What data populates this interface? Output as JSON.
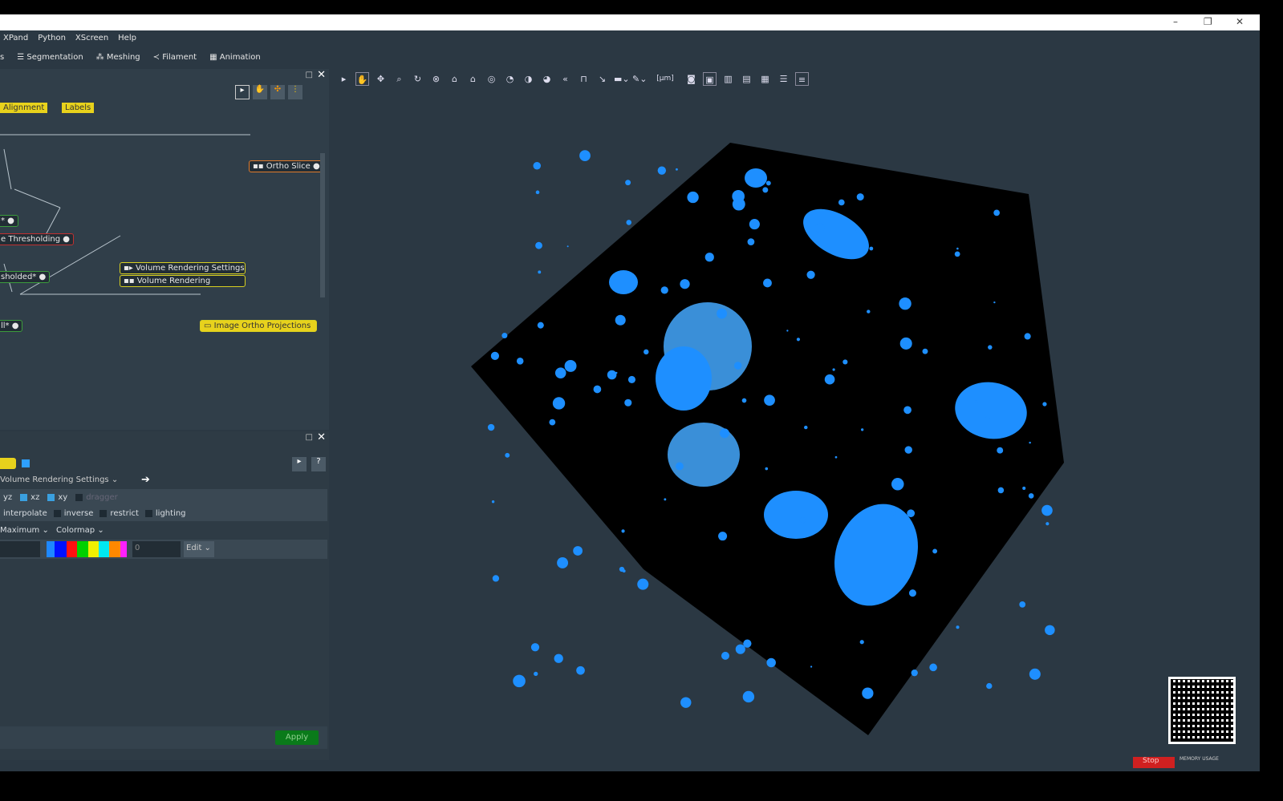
{
  "menu": [
    "XPand",
    "Python",
    "XScreen",
    "Help"
  ],
  "workspaces": [
    "s",
    "Segmentation",
    "Meshing",
    "Filament",
    "Animation"
  ],
  "tags": [
    "Alignment",
    "Labels"
  ],
  "nodes": {
    "ortho_slice": "Ortho Slice",
    "thresholding": "e Thresholding",
    "thresholded": "sholded*",
    "vr_settings": "Volume Rendering Settings",
    "vr": "Volume Rendering",
    "projections": "Image Ortho Projections",
    "n1": "*",
    "n2": "ll*"
  },
  "props": {
    "data_select": "Volume Rendering Settings",
    "checks": [
      {
        "label": "yz",
        "on": true
      },
      {
        "label": "xz",
        "on": true
      },
      {
        "label": "xy",
        "on": true
      },
      {
        "label": "dragger",
        "on": false
      }
    ],
    "options": [
      {
        "label": "interpolate",
        "on": false
      },
      {
        "label": "inverse",
        "on": false
      },
      {
        "label": "restrict",
        "on": false
      },
      {
        "label": "lighting",
        "on": false
      }
    ],
    "mode": "Maximum",
    "colormap_label": "Colormap",
    "value": "0",
    "edit": "Edit",
    "apply": "Apply"
  },
  "toolbar": {
    "unit": "[µm]"
  },
  "status": {
    "stop": "Stop",
    "memory": "MEMORY USAGE"
  },
  "colors": {
    "accent": "#1e8fff",
    "panel": "#303e49",
    "viewer": "#2b3843"
  }
}
